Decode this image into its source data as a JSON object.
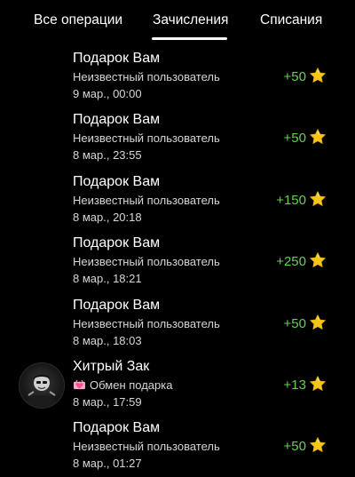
{
  "tabs": {
    "all": "Все операции",
    "credit": "Зачисления",
    "debit": "Списания",
    "active": "credit"
  },
  "colors": {
    "background": "#000000",
    "amount": "#5fd44b",
    "star": "#f5c518"
  },
  "transactions": [
    {
      "title": "Подарок Вам",
      "subtitle": "Неизвестный пользователь",
      "date": "9 мар., 00:00",
      "amount": "+50",
      "icon": "star-icon"
    },
    {
      "title": "Подарок Вам",
      "subtitle": "Неизвестный пользователь",
      "date": "8 мар., 23:55",
      "amount": "+50",
      "icon": "star-icon"
    },
    {
      "title": "Подарок Вам",
      "subtitle": "Неизвестный пользователь",
      "date": "8 мар., 20:18",
      "amount": "+150",
      "icon": "star-icon"
    },
    {
      "title": "Подарок Вам",
      "subtitle": "Неизвестный пользователь",
      "date": "8 мар., 18:21",
      "amount": "+250",
      "icon": "star-icon"
    },
    {
      "title": "Подарок Вам",
      "subtitle": "Неизвестный пользователь",
      "date": "8 мар., 18:03",
      "amount": "+50",
      "icon": "star-icon"
    },
    {
      "title": "Хитрый Зак",
      "subtitle": "Обмен подарка",
      "subtitle_icon": "gift-heart-icon",
      "date": "8 мар., 17:59",
      "amount": "+13",
      "icon": "star-icon",
      "avatar": "user-avatar"
    },
    {
      "title": "Подарок Вам",
      "subtitle": "Неизвестный пользователь",
      "date": "8 мар., 01:27",
      "amount": "+50",
      "icon": "star-icon"
    }
  ]
}
